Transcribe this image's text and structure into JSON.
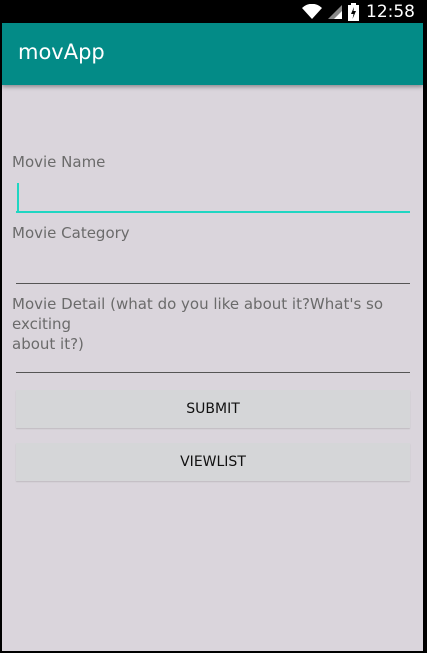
{
  "status_bar": {
    "time": "12:58",
    "icons": [
      "wifi-icon",
      "signal-icon",
      "battery-charging-icon"
    ]
  },
  "app_bar": {
    "title": "movApp",
    "color": "#038b87"
  },
  "form": {
    "movie_name": {
      "label": "Movie Name",
      "value": ""
    },
    "movie_category": {
      "label": "Movie Category",
      "value": ""
    },
    "movie_detail": {
      "label_line1": "Movie Detail (what do you like about it?What's so exciting",
      "label_line2": "about it?)",
      "value": ""
    }
  },
  "buttons": {
    "submit": "SUBMIT",
    "viewlist": "VIEWLIST"
  },
  "colors": {
    "accent": "#1fd6c2",
    "background": "#dad5dc",
    "button": "#d5d6d8"
  }
}
